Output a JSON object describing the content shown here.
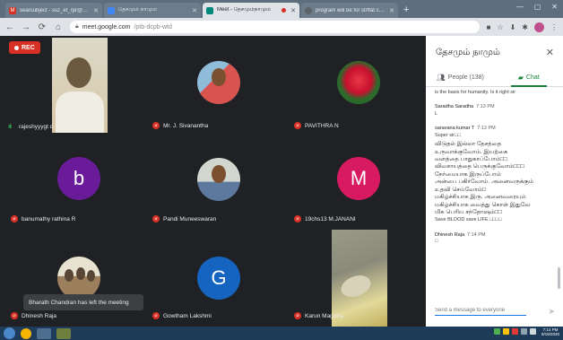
{
  "browser": {
    "tabs": [
      {
        "title": "searsubject - ssz_et_rpr@drty",
        "active": false,
        "color": "#d93025"
      },
      {
        "title": "தேசமும் நாமும்",
        "active": false,
        "color": "#4285f4"
      },
      {
        "title": "Meet - தேசமும்நாமும்",
        "active": true,
        "color": "#00897b"
      },
      {
        "title": "program will be for strffat chap",
        "active": false,
        "color": "#5f6368"
      }
    ],
    "url_domain": "meet.google.com",
    "url_path": "/ptb-dcpb-wtd"
  },
  "meeting": {
    "rec_label": "REC",
    "toast": "Bharath Chandran has left the meeting",
    "participants": [
      {
        "name": "rajeshyyygt d",
        "kind": "video",
        "colors": [
          "#6b5a40",
          "#d8c9a8"
        ]
      },
      {
        "name": "Mr. J. Sivanantha",
        "kind": "photo",
        "colors": [
          "#d9534f",
          "#8fbcd8"
        ]
      },
      {
        "name": "PAVITHRA N",
        "kind": "photo",
        "colors": [
          "#c8102e",
          "#2b6a2b"
        ]
      },
      {
        "name": "banumathy rathina R",
        "kind": "letter",
        "letter": "b",
        "colors": [
          "#6a1b9a"
        ]
      },
      {
        "name": "Pandi Muneeswaran",
        "kind": "photo",
        "colors": [
          "#5d7a9e",
          "#d3d6cf"
        ]
      },
      {
        "name": "19chs13 M.JANANI",
        "kind": "letter",
        "letter": "M",
        "colors": [
          "#d81b60"
        ]
      },
      {
        "name": "Dhinesh Raja",
        "kind": "photo",
        "colors": [
          "#9c7f5c",
          "#e8e2d0"
        ]
      },
      {
        "name": "Gowtham Lakshmi",
        "kind": "letter",
        "letter": "G",
        "colors": [
          "#1565c0"
        ]
      },
      {
        "name": "Karun Magolra",
        "kind": "video",
        "colors": [
          "#8a8a7a",
          "#e2d99a"
        ]
      }
    ]
  },
  "chat": {
    "title": "தேசமும் நாமும்",
    "people_tab": "People (138)",
    "chat_tab": "Chat",
    "messages": [
      {
        "sender": "",
        "time": "",
        "lines": [
          "is the basis for humanity. Is it right sir"
        ],
        "tamil": false
      },
      {
        "sender": "Saradha Saradha",
        "time": "7:13 PM",
        "lines": [
          "L"
        ],
        "tamil": false
      },
      {
        "sender": "saravana kumar T",
        "time": "7:13 PM",
        "lines": [
          "Super sir□□"
        ],
        "tamil": false
      },
      {
        "sender": "",
        "time": "",
        "lines": [
          "விடுதல் இல்லா தேசத்தை",
          "உருவாக்குவோம். இயற்கை",
          "வளத்தை பாதுகாப்போம்□□",
          "விவசாயத்தை பெருக்குவோம்□□□",
          "நேர்மையாக இருப்போம்",
          "அன்பை பகிர்வோம். அனைவருக்கும்",
          "உதவி செய்வோம்□",
          "மகிழ்ச்சியாக இரு. அனைவரையும்",
          "மகிழ்ச்சியாக வைத்து கொள் இதுவே",
          "மிக பெரிய சந்தோஷம்□□"
        ],
        "tamil": true
      },
      {
        "sender": "",
        "time": "",
        "lines": [
          "Save BLOOD save LIFE □□□□"
        ],
        "tamil": false
      },
      {
        "sender": "Dhinesh Raja",
        "time": "7:14 PM",
        "lines": [
          "□"
        ],
        "tamil": false
      }
    ],
    "input_placeholder": "Send a message to everyone"
  },
  "taskbar": {
    "time": "7:14 PM",
    "date": "8/19/2020"
  }
}
